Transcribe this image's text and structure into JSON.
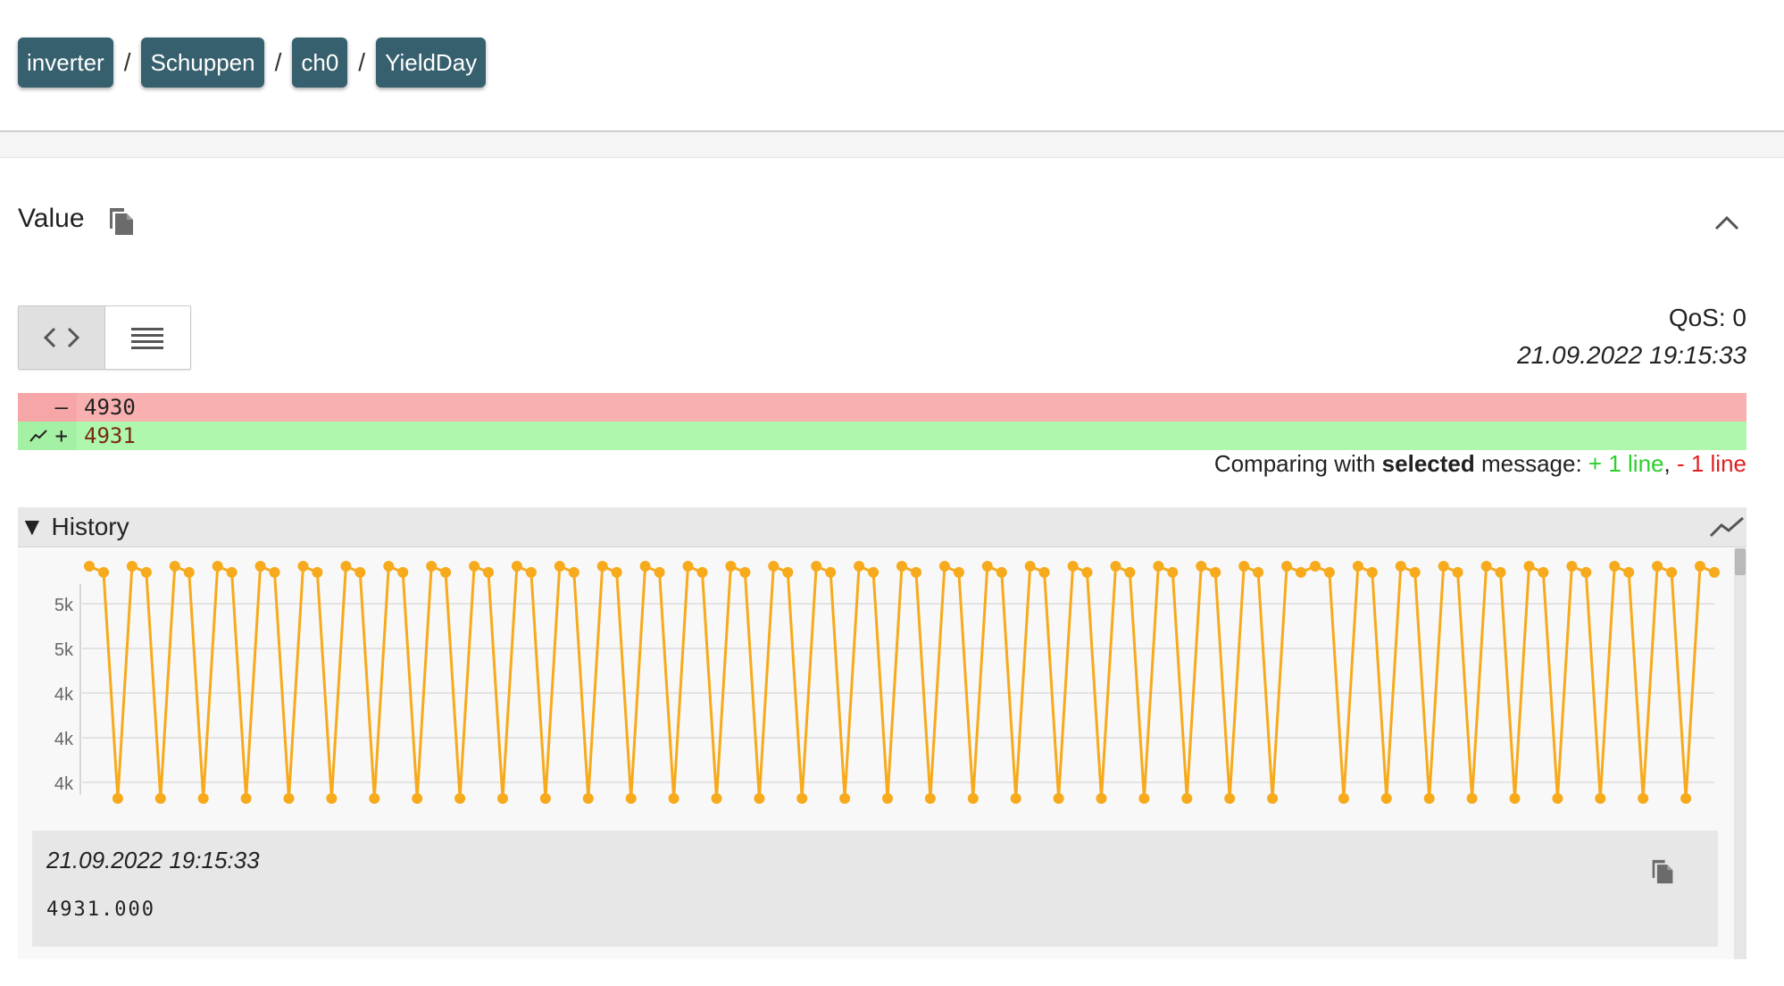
{
  "breadcrumb": {
    "items": [
      "inverter",
      "Schuppen",
      "ch0",
      "YieldDay"
    ],
    "separator": "/",
    "color": "#37606e"
  },
  "value_section": {
    "title": "Value",
    "qos": "QoS: 0",
    "timestamp": "21.09.2022 19:15:33"
  },
  "diff": {
    "removed": {
      "sign": "–",
      "text": "4930"
    },
    "added": {
      "sign": "+",
      "text": "4931"
    },
    "compare": {
      "prefix": "Comparing with ",
      "bold": "selected",
      "suffix": " message: ",
      "plus": "+ 1 line",
      "comma": ", ",
      "minus": "- 1 line"
    }
  },
  "history": {
    "title": "History",
    "toggle_glyph": "▼"
  },
  "tooltip": {
    "time": "21.09.2022 19:15:33",
    "value": "4931.000"
  },
  "colors": {
    "series": "#f6aa1c",
    "removed": "#f9b0b0",
    "added": "#aef7ad"
  },
  "chart_data": {
    "type": "line",
    "ytick_labels": [
      "5k",
      "5k",
      "4k",
      "4k",
      "4k"
    ],
    "grid": true,
    "series": [
      {
        "values": [
          5000,
          4980,
          4250,
          5000,
          4980,
          4250,
          5000,
          4980,
          4250,
          5000,
          4980,
          4250,
          5000,
          4980,
          4250,
          5000,
          4980,
          4250,
          5000,
          4980,
          4250,
          5000,
          4980,
          4250,
          5000,
          4980,
          4250,
          5000,
          4980,
          4250,
          5000,
          4980,
          4250,
          5000,
          4980,
          4250,
          5000,
          4980,
          4250,
          5000,
          4980,
          4250,
          5000,
          4980,
          4250,
          5000,
          4980,
          4250,
          5000,
          4980,
          4250,
          5000,
          4980,
          4250,
          5000,
          4980,
          4250,
          5000,
          4980,
          4250,
          5000,
          4980,
          4250,
          5000,
          4980,
          4250,
          5000,
          4980,
          4250,
          5000,
          4980,
          4250,
          5000,
          4980,
          4250,
          5000,
          4980,
          4250,
          5000,
          4980,
          4250,
          5000,
          4980,
          4250,
          5000,
          4980,
          5000,
          4980,
          4250,
          5000,
          4980,
          4250,
          5000,
          4980,
          4250,
          5000,
          4980,
          4250,
          5000,
          4980,
          4250,
          5000,
          4980,
          4250,
          5000,
          4980,
          4250,
          5000,
          4980,
          4250,
          5000,
          4980,
          4250,
          5000,
          4980
        ]
      }
    ]
  }
}
